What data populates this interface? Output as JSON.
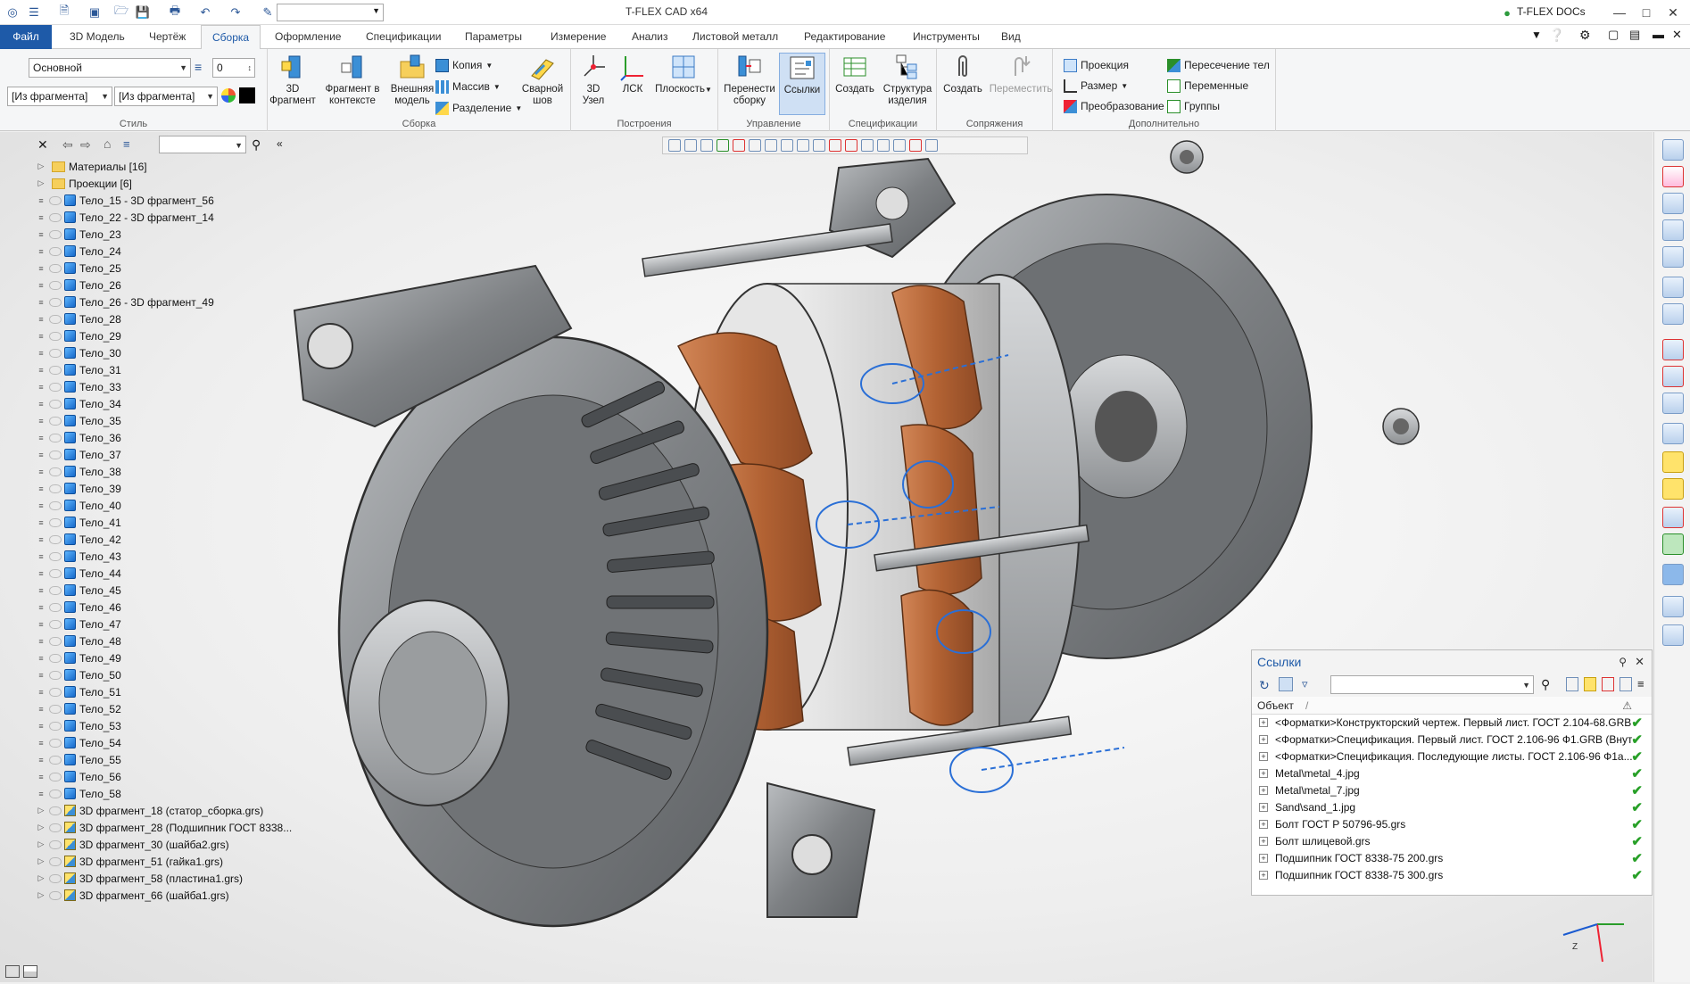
{
  "app": {
    "title": "T-FLEX CAD x64",
    "docs_label": "T-FLEX DOCs"
  },
  "tabs": [
    {
      "label": "Файл"
    },
    {
      "label": "3D Модель"
    },
    {
      "label": "Чертёж"
    },
    {
      "label": "Сборка"
    },
    {
      "label": "Оформление"
    },
    {
      "label": "Спецификации"
    },
    {
      "label": "Параметры"
    },
    {
      "label": "Измерение"
    },
    {
      "label": "Анализ"
    },
    {
      "label": "Листовой металл"
    },
    {
      "label": "Редактирование"
    },
    {
      "label": "Инструменты"
    },
    {
      "label": "Вид"
    }
  ],
  "ribbon": {
    "style": {
      "layer_value": "Основной",
      "level_value": "0",
      "combo1": "[Из фрагмента]",
      "combo2": "[Из фрагмента]",
      "group_label": "Стиль"
    },
    "assembly": {
      "btn_3d_fragment": "3D\nФрагмент",
      "btn_fragment_context": "Фрагмент в\nконтексте",
      "btn_external_model": "Внешняя\nмодель",
      "copy": "Копия",
      "array": "Массив",
      "split": "Разделение",
      "weld": "Сварной\nшов",
      "group_label": "Сборка"
    },
    "build": {
      "node3d": "3D\nУзел",
      "lcs": "ЛСК",
      "plane": "Плоскость",
      "group_label": "Построения"
    },
    "manage": {
      "move_assembly": "Перенести\nсборку",
      "links": "Ссылки",
      "group_label": "Управление"
    },
    "spec": {
      "create": "Создать",
      "structure": "Структура\nизделия",
      "group_label": "Спецификации"
    },
    "mates": {
      "create": "Создать",
      "move": "Переместить",
      "group_label": "Сопряжения"
    },
    "extra": {
      "projection": "Проекция",
      "size": "Размер",
      "transform": "Преобразование",
      "intersection": "Пересечение тел",
      "variables": "Переменные",
      "groups": "Группы",
      "group_label": "Дополнительно"
    }
  },
  "tree": [
    {
      "label": "Материалы [16]",
      "kind": "folder"
    },
    {
      "label": "Проекции [6]",
      "kind": "folder"
    },
    {
      "label": "Тело_15 - 3D фрагмент_56",
      "kind": "body"
    },
    {
      "label": "Тело_22 - 3D фрагмент_14",
      "kind": "body"
    },
    {
      "label": "Тело_23",
      "kind": "body"
    },
    {
      "label": "Тело_24",
      "kind": "body"
    },
    {
      "label": "Тело_25",
      "kind": "body"
    },
    {
      "label": "Тело_26",
      "kind": "body"
    },
    {
      "label": "Тело_26 - 3D фрагмент_49",
      "kind": "body"
    },
    {
      "label": "Тело_28",
      "kind": "body"
    },
    {
      "label": "Тело_29",
      "kind": "body"
    },
    {
      "label": "Тело_30",
      "kind": "body"
    },
    {
      "label": "Тело_31",
      "kind": "body"
    },
    {
      "label": "Тело_33",
      "kind": "body"
    },
    {
      "label": "Тело_34",
      "kind": "body"
    },
    {
      "label": "Тело_35",
      "kind": "body"
    },
    {
      "label": "Тело_36",
      "kind": "body"
    },
    {
      "label": "Тело_37",
      "kind": "body"
    },
    {
      "label": "Тело_38",
      "kind": "body"
    },
    {
      "label": "Тело_39",
      "kind": "body"
    },
    {
      "label": "Тело_40",
      "kind": "body"
    },
    {
      "label": "Тело_41",
      "kind": "body"
    },
    {
      "label": "Тело_42",
      "kind": "body"
    },
    {
      "label": "Тело_43",
      "kind": "body"
    },
    {
      "label": "Тело_44",
      "kind": "body"
    },
    {
      "label": "Тело_45",
      "kind": "body"
    },
    {
      "label": "Тело_46",
      "kind": "body"
    },
    {
      "label": "Тело_47",
      "kind": "body"
    },
    {
      "label": "Тело_48",
      "kind": "body"
    },
    {
      "label": "Тело_49",
      "kind": "body"
    },
    {
      "label": "Тело_50",
      "kind": "body"
    },
    {
      "label": "Тело_51",
      "kind": "body"
    },
    {
      "label": "Тело_52",
      "kind": "body"
    },
    {
      "label": "Тело_53",
      "kind": "body"
    },
    {
      "label": "Тело_54",
      "kind": "body"
    },
    {
      "label": "Тело_55",
      "kind": "body"
    },
    {
      "label": "Тело_56",
      "kind": "body"
    },
    {
      "label": "Тело_58",
      "kind": "body"
    },
    {
      "label": "3D фрагмент_18 (статор_сборка.grs)",
      "kind": "frag"
    },
    {
      "label": "3D фрагмент_28 (Подшипник ГОСТ 8338...",
      "kind": "frag"
    },
    {
      "label": "3D фрагмент_30 (шайба2.grs)",
      "kind": "frag"
    },
    {
      "label": "3D фрагмент_51 (гайка1.grs)",
      "kind": "frag"
    },
    {
      "label": "3D фрагмент_58 (пластина1.grs)",
      "kind": "frag"
    },
    {
      "label": "3D фрагмент_66 (шайба1.grs)",
      "kind": "frag"
    }
  ],
  "refs": {
    "title": "Ссылки",
    "column": "Объект",
    "rows": [
      "<Форматки>Конструкторский чертеж. Первый лист. ГОСТ 2.104-68.GRB",
      "<Форматки>Спецификация. Первый лист. ГОСТ 2.106-96 Ф1.GRB (Внут...",
      "<Форматки>Спецификация. Последующие листы. ГОСТ 2.106-96 Ф1а...",
      "Metal\\metal_4.jpg",
      "Metal\\metal_7.jpg",
      "Sand\\sand_1.jpg",
      "Болт ГОСТ Р 50796-95.grs",
      "Болт шлицевой.grs",
      "Подшипник ГОСТ 8338-75 200.grs",
      "Подшипник ГОСТ 8338-75 300.grs"
    ]
  },
  "colors": {
    "accent": "#1e5aa8",
    "copper": "#b86a3c",
    "metal": "#8a8c8e"
  }
}
